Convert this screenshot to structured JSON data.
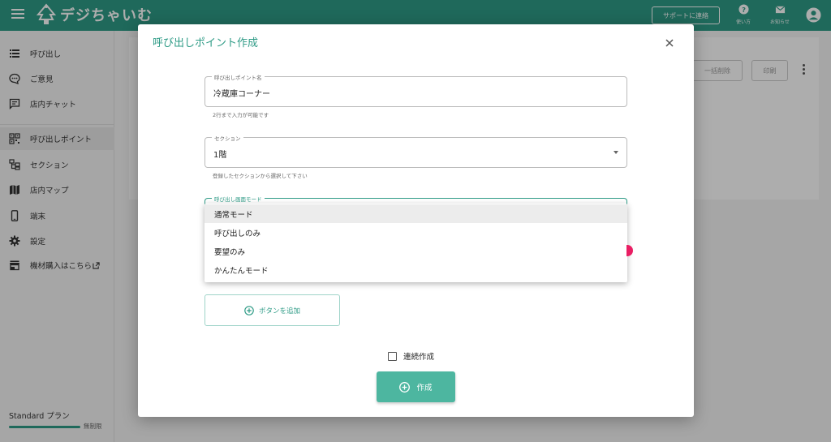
{
  "header": {
    "app_name": "デジちゃいむ",
    "support_label": "サポートに連絡",
    "help_label": "使い方",
    "news_label": "お知らせ"
  },
  "sidebar": {
    "items": [
      {
        "label": "呼び出し",
        "icon": "list-icon"
      },
      {
        "label": "ご意見",
        "icon": "feedback-icon"
      },
      {
        "label": "店内チャット",
        "icon": "chat-icon"
      },
      {
        "label": "呼び出しポイント",
        "icon": "qr-code-icon"
      },
      {
        "label": "セクション",
        "icon": "section-icon"
      },
      {
        "label": "店内マップ",
        "icon": "map-icon"
      },
      {
        "label": "端末",
        "icon": "phone-icon"
      },
      {
        "label": "設定",
        "icon": "gear-icon"
      },
      {
        "label": "機材購入はこちら",
        "icon": "store-icon"
      }
    ],
    "plan_label": "Standard プラン",
    "plan_limit": "無制限"
  },
  "main": {
    "bulk_delete_label": "一括削除",
    "print_label": "印刷"
  },
  "dialog": {
    "title": "呼び出しポイント作成",
    "name_field": {
      "legend": "呼び出しポイント名",
      "value": "冷蔵庫コーナー",
      "helper": "2行まで入力が可能です"
    },
    "section_field": {
      "legend": "セクション",
      "value": "1階",
      "helper": "登録したセクションから選択して下さい"
    },
    "mode_field": {
      "legend": "呼び出し画面モード",
      "options": [
        "通常モード",
        "呼び出しのみ",
        "要望のみ",
        "かんたんモード"
      ],
      "selected": "通常モード"
    },
    "add_button_label": "ボタンを追加",
    "continuous_label": "連続作成",
    "create_label": "作成"
  },
  "colors": {
    "brand": "#2e9b86",
    "create_button": "#4db6a0",
    "badge": "#e91e63"
  }
}
